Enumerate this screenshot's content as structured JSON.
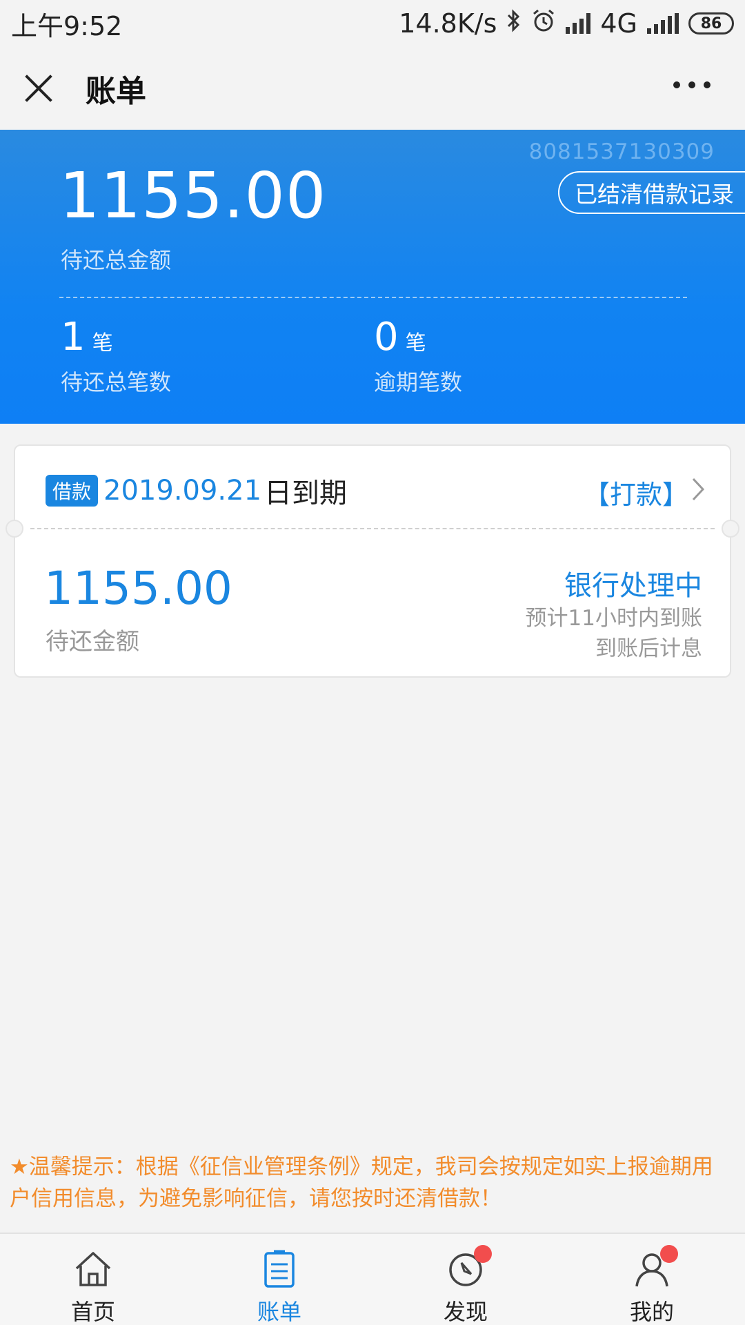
{
  "status_bar": {
    "time": "上午9:52",
    "net_speed": "14.8K/s",
    "network": "4G",
    "battery": "86",
    "icons": [
      "bluetooth-icon",
      "alarm-icon",
      "hd-signal-icon",
      "signal-icon",
      "battery-icon"
    ]
  },
  "header": {
    "title": "账单"
  },
  "summary": {
    "contract_no": "8081537130309",
    "settled_button": "已结清借款记录",
    "total_amount": "1155.00",
    "total_label": "待还总金额",
    "pending_count": "1",
    "pending_unit": "笔",
    "pending_label": "待还总笔数",
    "overdue_count": "0",
    "overdue_unit": "笔",
    "overdue_label": "逾期笔数"
  },
  "bill": {
    "tag": "借款",
    "due_date": "2019.09.21",
    "due_suffix": "日到期",
    "pay_link": "【打款】",
    "amount": "1155.00",
    "amount_label": "待还金额",
    "status": "银行处理中",
    "eta_line1": "预计11小时内到账",
    "eta_line2": "到账后计息"
  },
  "tip": {
    "text": "★温馨提示：根据《征信业管理条例》规定，我司会按规定如实上报逾期用户信用信息，为避免影响征信，请您按时还清借款！"
  },
  "tabbar": {
    "items": [
      {
        "label": "首页",
        "icon": "home-icon"
      },
      {
        "label": "账单",
        "icon": "bill-icon",
        "active": true
      },
      {
        "label": "发现",
        "icon": "compass-icon",
        "badge": true
      },
      {
        "label": "我的",
        "icon": "user-icon",
        "badge": true
      }
    ]
  },
  "colors": {
    "accent": "#1a86e0",
    "banner": "#1183f2",
    "warning": "#f28c2c",
    "badge": "#f24d4d"
  }
}
